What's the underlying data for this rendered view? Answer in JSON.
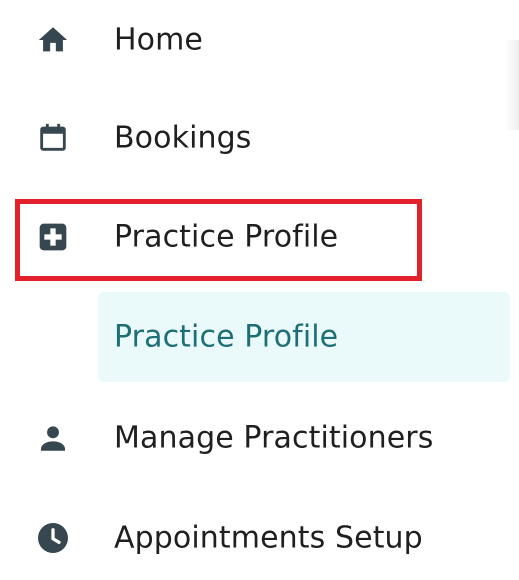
{
  "nav": {
    "items": [
      {
        "label": "Home",
        "icon": "home-icon"
      },
      {
        "label": "Bookings",
        "icon": "calendar-icon"
      },
      {
        "label": "Practice Profile",
        "icon": "medical-plus-icon"
      },
      {
        "label": "Manage Practitioners",
        "icon": "person-icon"
      },
      {
        "label": "Appointments Setup",
        "icon": "clock-icon"
      }
    ],
    "sub_item": {
      "label": "Practice Profile"
    }
  },
  "colors": {
    "icon": "#37474f",
    "text": "#1f1f1f",
    "active_text": "#1e6f75",
    "active_bg": "#eaf9f9",
    "highlight": "#e3212b"
  }
}
